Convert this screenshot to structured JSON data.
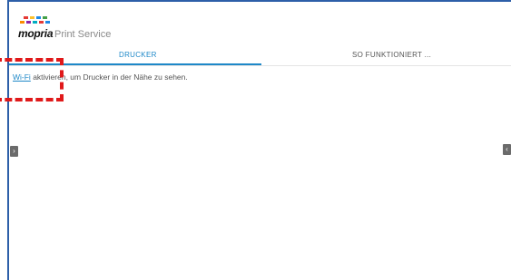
{
  "app": {
    "logo_text": "mopria",
    "title": "Print Service",
    "menu_icon": "more-vert-icon"
  },
  "tabs": [
    {
      "label": "DRUCKER",
      "selected": true
    },
    {
      "label": "SO FUNKTIONIERT ...",
      "selected": false
    }
  ],
  "message": {
    "link_text": "Wi-Fi",
    "text": " aktivieren, um Drucker in der Nähe zu sehen."
  },
  "side_buttons": {
    "left_icon": "chevron-right-icon",
    "right_icon": "chevron-left-icon"
  },
  "colors": {
    "accent": "#1e88c8",
    "highlight": "#e0191a",
    "frame": "#2e5fa8"
  }
}
